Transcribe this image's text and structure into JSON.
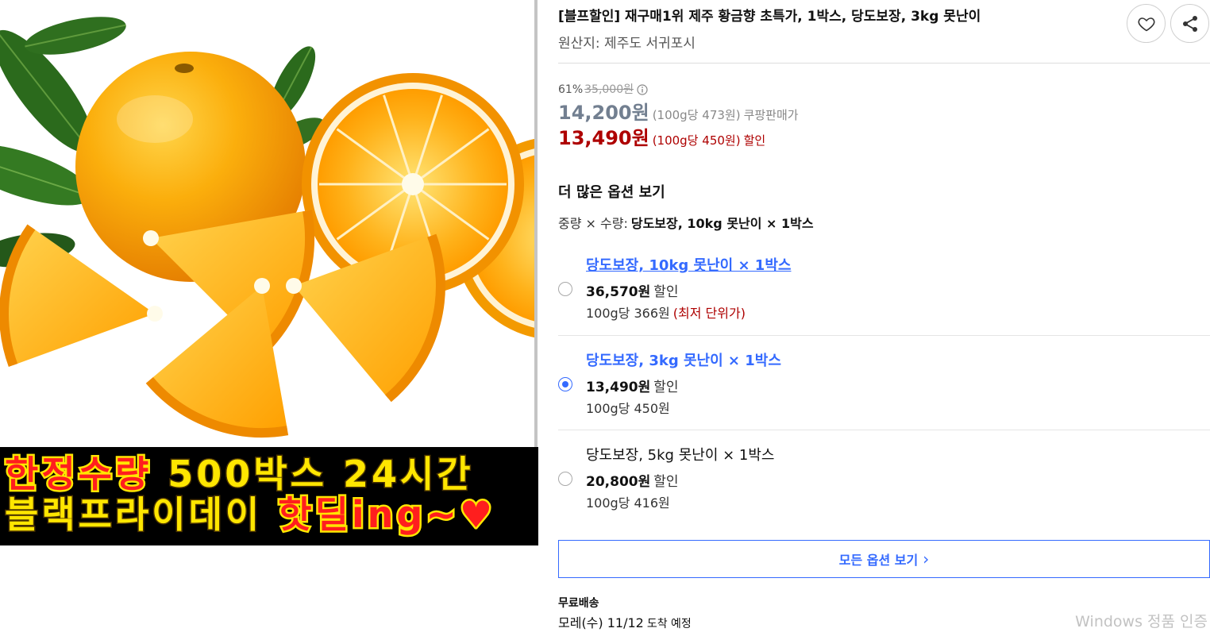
{
  "product_image": {
    "photo_icon": "orange-product-photo",
    "banner": {
      "line1_red": "한정수량",
      "line1_yellow": "500박스 24시간",
      "line2_yellow": "블랙프라이데이",
      "line2_red": "핫딜ing~♥"
    }
  },
  "product": {
    "title": "[블프할인] 재구매1위 제주 황금향 초특가, 1박스, 당도보장, 3kg 못난이",
    "origin": "원산지: 제주도 서귀포시",
    "wishlist_icon": "heart-icon",
    "share_icon": "share-icon"
  },
  "price": {
    "discount_rate": "61%",
    "original_price": "35,000원",
    "info_icon": "info-icon",
    "sale_price": "14,200원",
    "sale_unit_price": "(100g당 473원)",
    "sale_label": "쿠팡판매가",
    "final_price": "13,490원",
    "final_unit_price": "(100g당 450원)",
    "final_label": "할인"
  },
  "options": {
    "heading": "더 많은 옵션 보기",
    "selected_label": "중량 × 수량:",
    "selected_value": "당도보장, 10kg 못난이 × 1박스",
    "items": [
      {
        "name": "당도보장, 10kg 못난이 × 1박스",
        "price": "36,570원",
        "price_label": "할인",
        "unit_price": "100g당 366원",
        "note": "(최저 단위가)",
        "checked": false
      },
      {
        "name": "당도보장, 3kg 못난이 × 1박스",
        "price": "13,490원",
        "price_label": "할인",
        "unit_price": "100g당 450원",
        "checked": true
      },
      {
        "name": "당도보장, 5kg 못난이 × 1박스",
        "price": "20,800원",
        "price_label": "할인",
        "unit_price": "100g당 416원",
        "checked": false
      }
    ],
    "all_options_label": "모든 옵션 보기",
    "all_options_icon": "chevron-right-icon"
  },
  "shipping": {
    "label": "무료배송",
    "eta_date": "모레(수) 11/12",
    "eta_text": "도착 예정"
  },
  "system": {
    "watermark": "Windows 정품 인증"
  },
  "colors": {
    "accent": "#346aff",
    "discount_red": "#ae0000",
    "sale_gray": "#727f90",
    "banner_bg": "#000000",
    "banner_yellow": "#ffe600",
    "banner_red": "#ff1e1e"
  }
}
